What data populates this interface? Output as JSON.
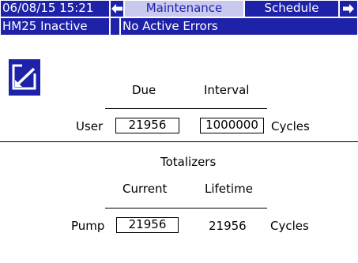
{
  "header": {
    "datetime": "06/08/15 15:21",
    "tab_active": "Maintenance",
    "tab_next": "Schedule",
    "icons": {
      "prev": "left-arrow-icon",
      "next": "right-arrow-icon"
    }
  },
  "status": {
    "system": "HM25 Inactive",
    "errors": "No Active Errors"
  },
  "edit": {
    "icon": "edit-icon"
  },
  "user_section": {
    "col_due": "Due",
    "col_interval": "Interval",
    "row_label": "User",
    "due_value": "21956",
    "interval_value": "1000000",
    "unit": "Cycles"
  },
  "totalizers": {
    "title": "Totalizers",
    "col_current": "Current",
    "col_lifetime": "Lifetime",
    "row_label": "Pump",
    "current_value": "21956",
    "lifetime_value": "21956",
    "unit": "Cycles"
  },
  "colors": {
    "bar": "#1e22a8",
    "tab_active_bg": "#c9c9f0"
  }
}
